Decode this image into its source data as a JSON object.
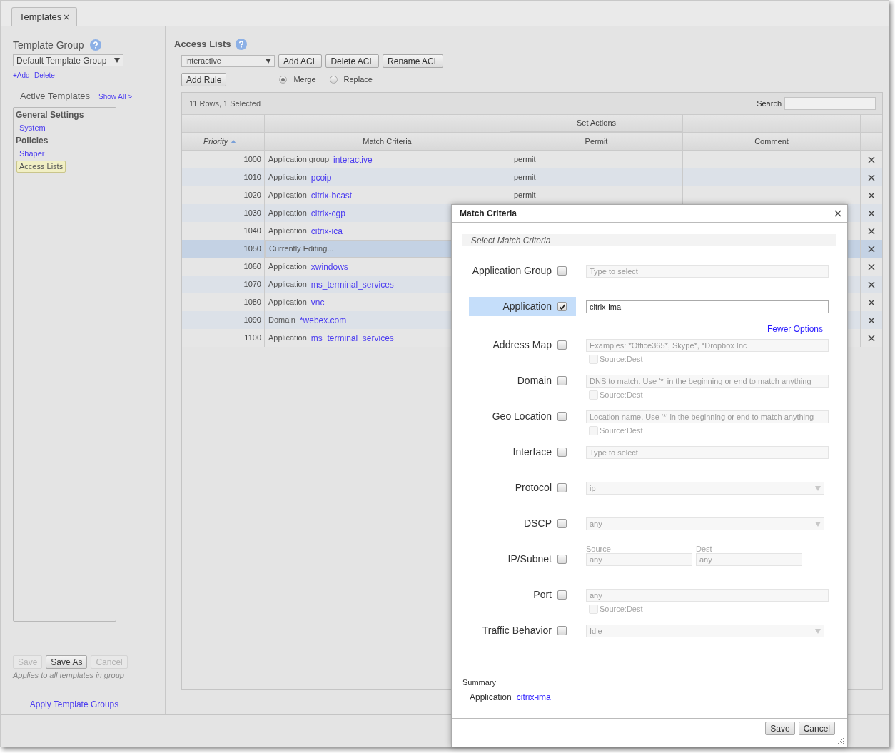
{
  "tabs": [
    {
      "label": "Templates",
      "selected": true
    }
  ],
  "left": {
    "template_group": {
      "title": "Template Group",
      "value": "Default Template Group"
    },
    "links": [
      "+Add",
      "-Delete"
    ],
    "active_templates": {
      "title": "Active Templates",
      "show_all": "Show All >",
      "items": [
        {
          "kind": "heading",
          "label": "General Settings"
        },
        {
          "kind": "link",
          "label": "System",
          "selected": false
        },
        {
          "kind": "heading",
          "label": "Policies"
        },
        {
          "kind": "link",
          "label": "Shaper",
          "selected": false
        },
        {
          "kind": "link",
          "label": "Access Lists",
          "selected": true
        }
      ]
    },
    "buttons": [
      {
        "label": "Save",
        "disabled": true
      },
      {
        "label": "Save As",
        "disabled": false
      },
      {
        "label": "Cancel",
        "disabled": true
      }
    ],
    "note": "Applies to all templates in group",
    "apply_link": "Apply Template Groups"
  },
  "access_lists": {
    "title": "Access Lists",
    "acl_select": "Interactive",
    "buttons": [
      "Add ACL",
      "Delete ACL",
      "Rename ACL"
    ],
    "add_rule": "Add Rule",
    "modes": [
      {
        "label": "Merge",
        "selected": true
      },
      {
        "label": "Replace",
        "selected": false
      }
    ],
    "table": {
      "summary": "11 Rows, 1 Selected",
      "search_label": "Search",
      "group_header": "Set Actions",
      "columns": [
        {
          "label": "Priority",
          "sorted": true
        },
        {
          "label": "Match Criteria",
          "sorted": false
        },
        {
          "label": "Permit",
          "sorted": false
        },
        {
          "label": "Comment",
          "sorted": false
        }
      ],
      "rows": [
        {
          "priority": "1000",
          "criteria": "Application group",
          "value": "interactive",
          "permit": "permit",
          "selected": false
        },
        {
          "priority": "1010",
          "criteria": "Application",
          "value": "pcoip",
          "permit": "permit",
          "selected": false
        },
        {
          "priority": "1020",
          "criteria": "Application",
          "value": "citrix-bcast",
          "permit": "permit",
          "selected": false
        },
        {
          "priority": "1030",
          "criteria": "Application",
          "value": "citrix-cgp",
          "selected": false
        },
        {
          "priority": "1040",
          "criteria": "Application",
          "value": "citrix-ica",
          "selected": false
        },
        {
          "priority": "1050",
          "criteria": "Currently Editing...",
          "selected": true
        },
        {
          "priority": "1060",
          "criteria": "Application",
          "value": "xwindows",
          "selected": false
        },
        {
          "priority": "1070",
          "criteria": "Application",
          "value": "ms_terminal_services",
          "selected": false
        },
        {
          "priority": "1080",
          "criteria": "Application",
          "value": "vnc",
          "selected": false
        },
        {
          "priority": "1090",
          "criteria": "Domain",
          "value": "*webex.com",
          "selected": false
        },
        {
          "priority": "1100",
          "criteria": "Application",
          "value": "ms_terminal_services",
          "selected": false
        }
      ]
    }
  },
  "dialog": {
    "title": "Match Criteria",
    "section": "Select Match Criteria",
    "criteria": [
      {
        "label": "Application Group",
        "checked": false,
        "kind": "text",
        "placeholder": "Type to select"
      },
      {
        "label": "Application",
        "checked": true,
        "kind": "text",
        "value": "citrix-ima",
        "link": "Fewer Options"
      },
      {
        "label": "Address Map",
        "checked": false,
        "kind": "text",
        "placeholder": "Examples: *Office365*, Skype*, *Dropbox Inc",
        "option": {
          "label": "Source:Dest",
          "checked": false
        }
      },
      {
        "label": "Domain",
        "checked": false,
        "kind": "text",
        "placeholder": "DNS to match. Use '*' in the beginning or end to match anything",
        "option": {
          "label": "Source:Dest",
          "checked": false
        }
      },
      {
        "label": "Geo Location",
        "checked": false,
        "kind": "text",
        "placeholder": "Location name. Use '*' in the beginning or end to match anything",
        "option": {
          "label": "Source:Dest",
          "checked": false
        }
      },
      {
        "label": "Interface",
        "checked": false,
        "kind": "text",
        "placeholder": "Type to select"
      },
      {
        "label": "Protocol",
        "checked": false,
        "kind": "select",
        "value": "ip"
      },
      {
        "label": "DSCP",
        "checked": false,
        "kind": "select",
        "value": "any"
      },
      {
        "label": "IP/Subnet",
        "checked": false,
        "kind": "pair",
        "fields": [
          {
            "label": "Source",
            "placeholder": "any"
          },
          {
            "label": "Dest",
            "placeholder": "any"
          }
        ]
      },
      {
        "label": "Port",
        "checked": false,
        "kind": "text",
        "placeholder": "any",
        "option": {
          "label": "Source:Dest",
          "checked": false
        }
      },
      {
        "label": "Traffic Behavior",
        "checked": false,
        "kind": "select",
        "value": "Idle"
      }
    ],
    "summary": {
      "title": "Summary",
      "label": "Application",
      "value": "citrix-ima"
    },
    "buttons": [
      "Save",
      "Cancel"
    ]
  }
}
